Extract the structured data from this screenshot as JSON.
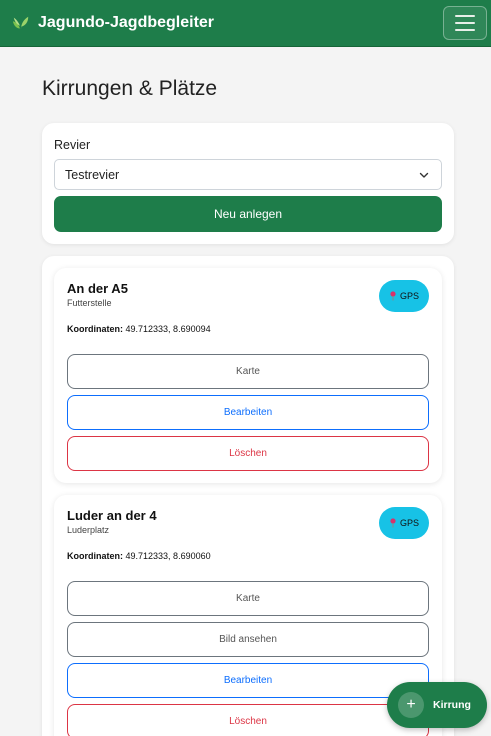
{
  "navbar": {
    "brand": "Jagundo-Jagdbegleiter",
    "logo_icon": "leaf-icon",
    "menu_icon": "hamburger-menu-icon"
  },
  "page": {
    "title": "Kirrungen & Plätze"
  },
  "filter": {
    "label": "Revier",
    "selected": "Testrevier",
    "new_button": "Neu anlegen"
  },
  "entries": [
    {
      "title": "An der A5",
      "type": "Futterstelle",
      "gps_label": "GPS",
      "coords_label": "Koordinaten:",
      "coords": "49.712333, 8.690094",
      "buttons": {
        "map": "Karte",
        "edit": "Bearbeiten",
        "delete": "Löschen"
      }
    },
    {
      "title": "Luder an der 4",
      "type": "Luderplatz",
      "gps_label": "GPS",
      "coords_label": "Koordinaten:",
      "coords": "49.712333, 8.690060",
      "buttons": {
        "map": "Karte",
        "image": "Bild ansehen",
        "edit": "Bearbeiten",
        "delete": "Löschen"
      }
    }
  ],
  "fab": {
    "icon": "plus-icon",
    "label": "Kirrung"
  },
  "colors": {
    "brand_green": "#1e7d4a",
    "gps_cyan": "#17c2e6",
    "edit_blue": "#0d6efd",
    "delete_red": "#dc3545"
  }
}
